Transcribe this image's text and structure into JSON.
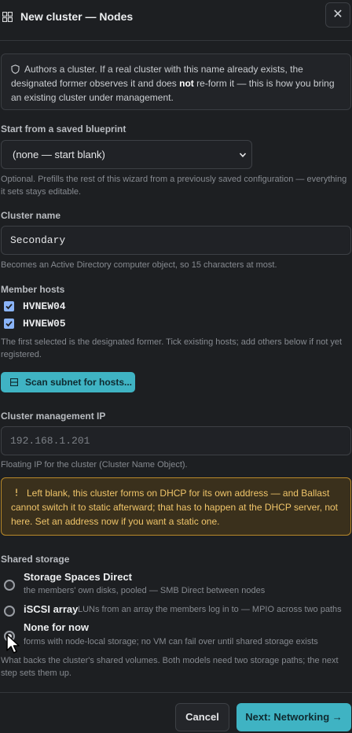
{
  "header": {
    "title": "New cluster — Nodes",
    "close_label": "✕"
  },
  "info": {
    "text_before": "Authors a cluster. If a real cluster with this name already exists, the designated former observes it and does ",
    "text_bold": "not",
    "text_after": " re-form it — this is how you bring an existing cluster under management."
  },
  "blueprint": {
    "label": "Start from a saved blueprint",
    "selected": "(none — start blank)",
    "help": "Optional. Prefills the rest of this wizard from a previously saved configuration — everything it sets stays editable."
  },
  "cluster_name": {
    "label": "Cluster name",
    "value": "Secondary",
    "help": "Becomes an Active Directory computer object, so 15 characters at most."
  },
  "member_hosts": {
    "label": "Member hosts",
    "hosts": [
      {
        "name": "HVNEW04",
        "checked": true
      },
      {
        "name": "HVNEW05",
        "checked": true
      }
    ],
    "help": "The first selected is the designated former. Tick existing hosts; add others below if not yet registered.",
    "scan_label": "Scan subnet for hosts..."
  },
  "mgmt_ip": {
    "label": "Cluster management IP",
    "placeholder": "192.168.1.201",
    "help": "Floating IP for the cluster (Cluster Name Object)."
  },
  "warning": {
    "text": "Left blank, this cluster forms on DHCP for its own address — and Ballast cannot switch it to static afterward; that has to happen at the DHCP server, not here. Set an address now if you want a static one."
  },
  "storage": {
    "label": "Shared storage",
    "options": [
      {
        "title": "Storage Spaces Direct",
        "desc": "the members' own disks, pooled — SMB Direct between nodes",
        "checked": false
      },
      {
        "title": "iSCSI array",
        "desc": "LUNs from an array the members log in to — MPIO across two paths",
        "checked": false
      },
      {
        "title": "None for now",
        "desc": "forms with node-local storage; no VM can fail over until shared storage exists",
        "checked": true
      }
    ],
    "help": "What backs the cluster's shared volumes. Both models need two storage paths; the next step sets them up."
  },
  "footer": {
    "cancel_label": "Cancel",
    "next_label": "Next: Networking →"
  },
  "colors": {
    "background": "#1d1f22",
    "accent": "#3fb3c3",
    "warning_border": "#b8892a",
    "warning_text": "#f0c56a",
    "checkbox": "#8ab4f8"
  }
}
